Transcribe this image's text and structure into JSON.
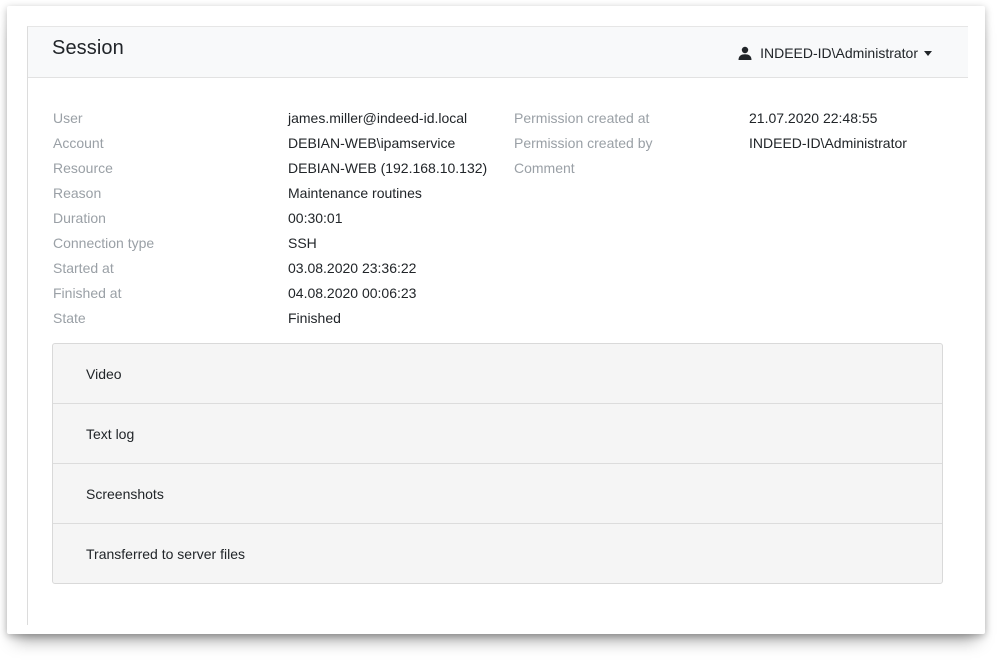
{
  "header": {
    "title": "Session",
    "user_menu": {
      "icon": "user-icon",
      "label": "INDEED-ID\\Administrator"
    }
  },
  "session": {
    "left": [
      {
        "label": "User",
        "value": "james.miller@indeed-id.local"
      },
      {
        "label": "Account",
        "value": "DEBIAN-WEB\\ipamservice"
      },
      {
        "label": "Resource",
        "value": "DEBIAN-WEB (192.168.10.132)"
      },
      {
        "label": "Reason",
        "value": "Maintenance routines"
      },
      {
        "label": "Duration",
        "value": "00:30:01"
      },
      {
        "label": "Connection type",
        "value": "SSH"
      },
      {
        "label": "Started at",
        "value": "03.08.2020 23:36:22"
      },
      {
        "label": "Finished at",
        "value": "04.08.2020 00:06:23"
      },
      {
        "label": "State",
        "value": "Finished"
      }
    ],
    "right": [
      {
        "label": "Permission created at",
        "value": "21.07.2020 22:48:55"
      },
      {
        "label": "Permission created by",
        "value": "INDEED-ID\\Administrator"
      },
      {
        "label": "Comment",
        "value": ""
      }
    ]
  },
  "accordion": [
    {
      "label": "Video"
    },
    {
      "label": "Text log"
    },
    {
      "label": "Screenshots"
    },
    {
      "label": "Transferred to server files"
    }
  ]
}
